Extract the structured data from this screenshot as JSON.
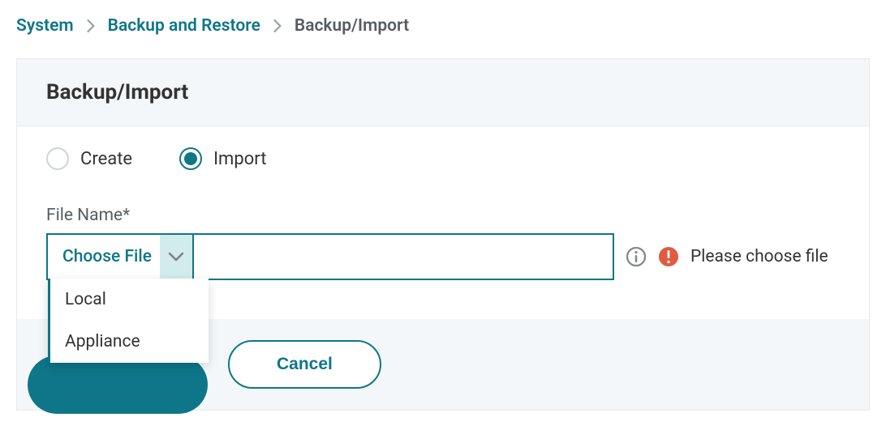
{
  "breadcrumb": {
    "items": [
      {
        "label": "System",
        "link": true
      },
      {
        "label": "Backup and Restore",
        "link": true
      },
      {
        "label": "Backup/Import",
        "link": false
      }
    ]
  },
  "panel": {
    "title": "Backup/Import"
  },
  "radios": {
    "create": "Create",
    "import": "Import",
    "selected": "import"
  },
  "file": {
    "label": "File Name*",
    "choose": "Choose File",
    "value": "",
    "error": "Please choose file",
    "dropdown": [
      "Local",
      "Appliance"
    ]
  },
  "buttons": {
    "cancel": "Cancel"
  }
}
